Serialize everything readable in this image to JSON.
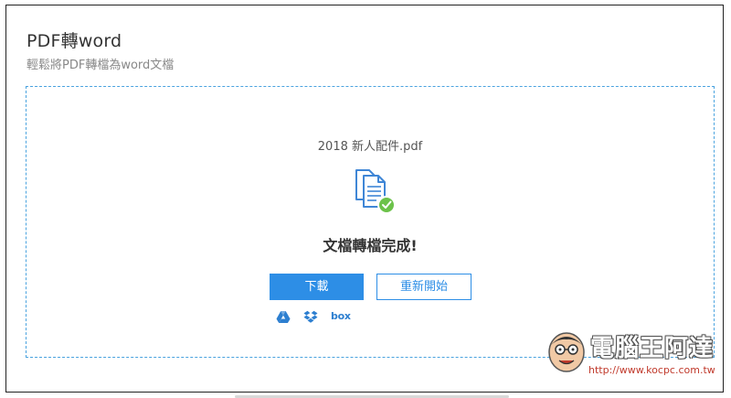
{
  "header": {
    "title": "PDF轉word",
    "subtitle": "輕鬆將PDF轉檔為word文檔"
  },
  "conversion": {
    "file_name": "2018 新人配件.pdf",
    "status": "文檔轉檔完成!",
    "download_label": "下載",
    "restart_label": "重新開始"
  },
  "cloud_services": {
    "icons": [
      "google-drive-icon",
      "dropbox-icon",
      "box-icon"
    ],
    "box_label": "box"
  },
  "watermark": {
    "title": "電腦王阿達",
    "url": "http://www.kocpc.com.tw"
  },
  "colors": {
    "accent": "#2d8ee6",
    "dashed_border": "#4aa3df",
    "success": "#6cc24a"
  }
}
